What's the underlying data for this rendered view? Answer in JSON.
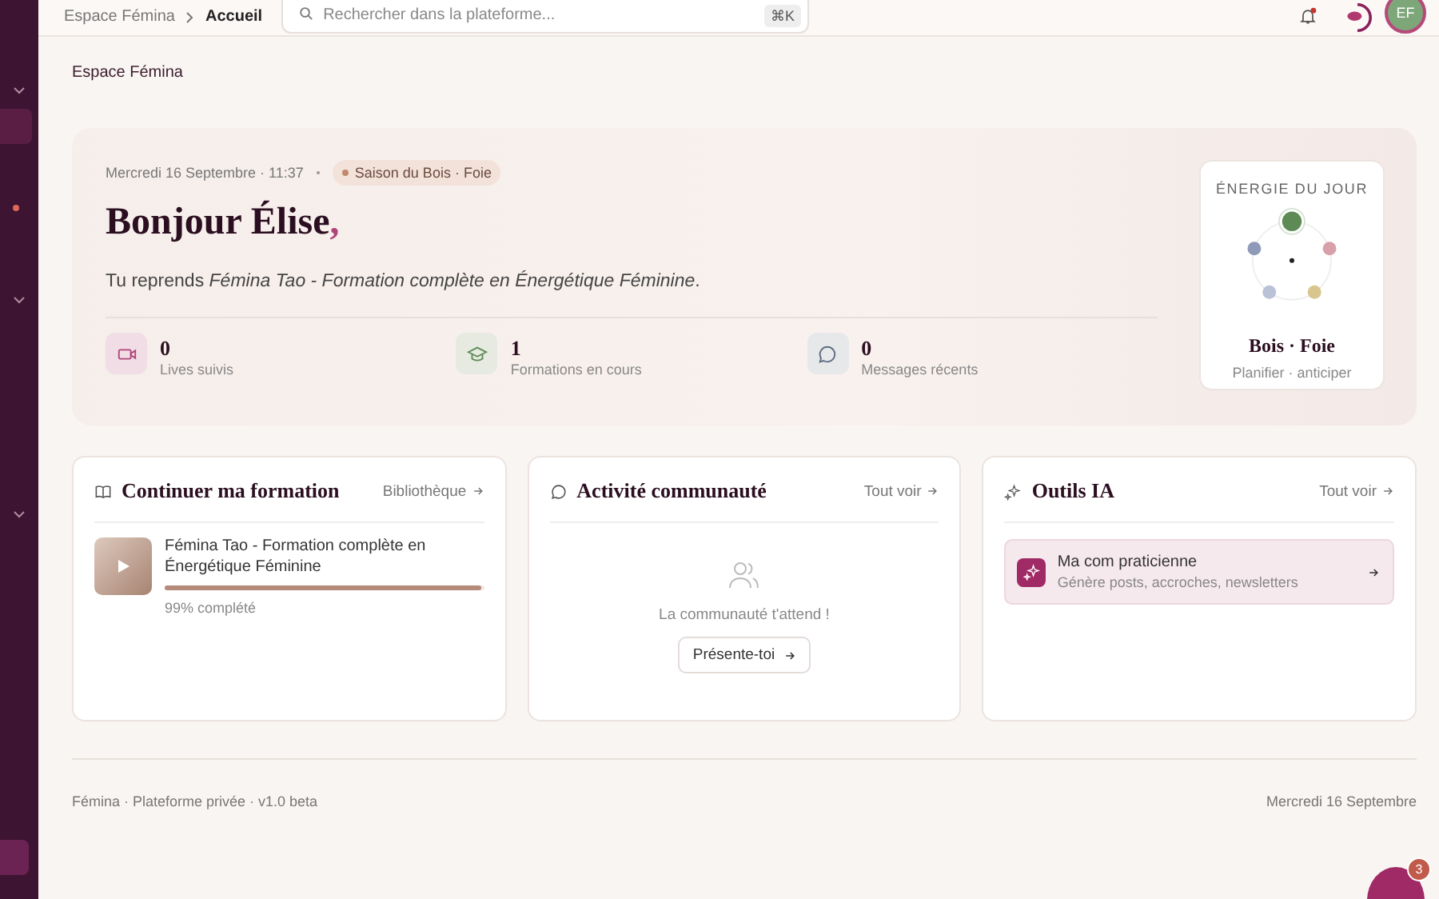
{
  "breadcrumb": [
    {
      "label": "Espace Fémina",
      "selected": false
    },
    {
      "label": "Accueil",
      "selected": true
    }
  ],
  "search": {
    "placeholder": "Rechercher dans la plateforme...",
    "shortcut": "⌘K"
  },
  "avatar": {
    "initials": "EF"
  },
  "page_title": "Espace Fémina",
  "hero": {
    "datetime": "Mercredi 16 Septembre · 11:37",
    "season": "Saison du Bois · Foie",
    "greeting": "Bonjour Élise",
    "greeting_mark": ",",
    "resume": "Tu reprends *Fémina Tao - Formation complète en Énergétique Féminine*.",
    "stats": [
      {
        "kind": "video",
        "value": "0",
        "label": "Lives suivis"
      },
      {
        "kind": "course",
        "value": "1",
        "label": "Formations en cours"
      },
      {
        "kind": "message",
        "value": "0",
        "label": "Messages récents"
      }
    ]
  },
  "energy": {
    "title": "ÉNERGIE DU JOUR",
    "name": "Bois · Foie",
    "hint": "Planifier · anticiper",
    "elements": [
      {
        "color": "#5e8a55",
        "selected": true
      },
      {
        "color": "#d8a0aa",
        "selected": false
      },
      {
        "color": "#d9c68e",
        "selected": false
      },
      {
        "color": "#b9c2d6",
        "selected": false
      },
      {
        "color": "#8f9ab8",
        "selected": false
      }
    ]
  },
  "cards": [
    {
      "kind": "course",
      "title": "Continuer ma formation",
      "link": "Bibliothèque",
      "course_title": "Fémina Tao - Formation complète en Énergétique Féminine",
      "level": 0.99,
      "progress_text": "99% complété"
    },
    {
      "kind": "community",
      "title": "Activité communauté",
      "link": "Tout voir",
      "empty_text": "La communauté t'attend !",
      "button": "Présente-toi"
    },
    {
      "kind": "tools",
      "title": "Outils IA",
      "link": "Tout voir",
      "tool_name": "Ma com praticienne",
      "tool_desc": "Génère posts, accroches, newsletters"
    }
  ],
  "footer": {
    "left": "Fémina · Plateforme privée · v1.0 beta",
    "right": "Mercredi 16 Septembre"
  },
  "chat_badge": "3"
}
